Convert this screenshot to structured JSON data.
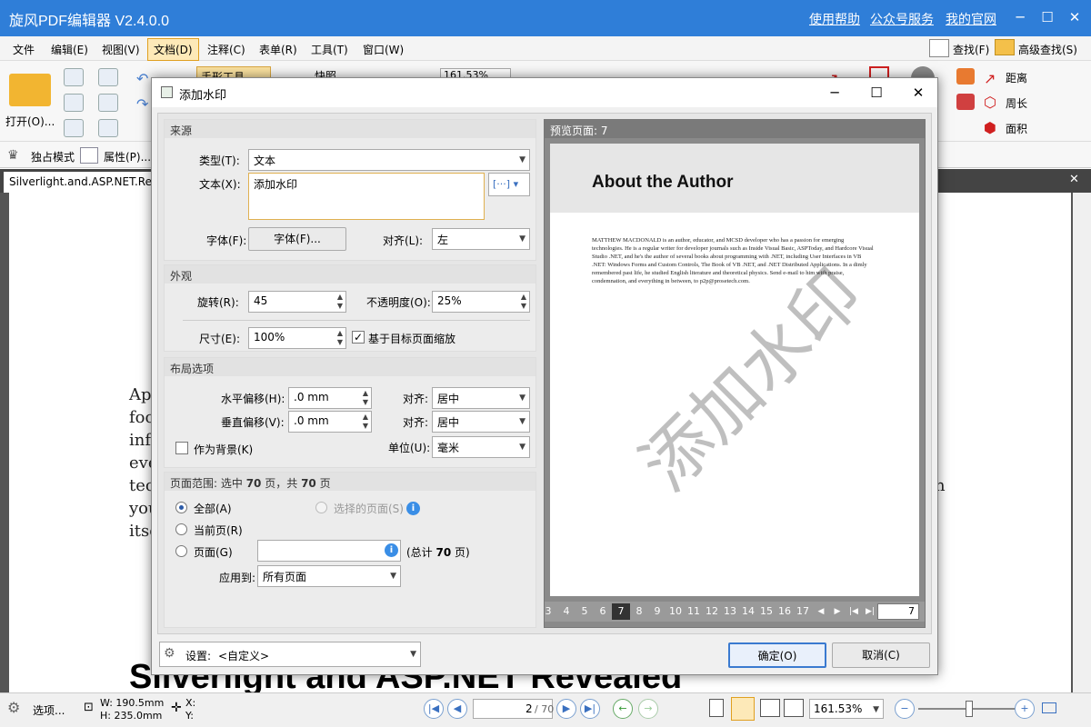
{
  "app": {
    "title": "旋风PDF编辑器 V2.4.0.0",
    "links": [
      "使用帮助",
      "公众号服务",
      "我的官网"
    ]
  },
  "menu": [
    "文件",
    "编辑(E)",
    "视图(V)",
    "文档(D)",
    "注释(C)",
    "表单(R)",
    "工具(T)",
    "窗口(W)"
  ],
  "ribbon": {
    "open_label": "打开(O)...",
    "hand_tool": "手形工具",
    "snapshot": "快照",
    "zoom_value": "161.53%",
    "exclusive_mode": "独占模式",
    "properties": "属性(P)...",
    "find": "查找(F)",
    "advanced_find": "高级查找(S)",
    "distance": "距离",
    "perimeter": "周长",
    "area": "面积"
  },
  "doc_tab": "Silverlight.and.ASP.NET.Revea",
  "page_text": {
    "lines": [
      "Ap",
      "foc",
      "inf",
      "eve",
      "tec",
      "you",
      "itse"
    ],
    "right_fragment": "n",
    "heading": "Silverlight and ASP.NET Revealed"
  },
  "statusbar": {
    "select": "选项...",
    "width": "W: 190.5mm",
    "height": "H: 235.0mm",
    "x": "X:",
    "y": "Y:",
    "page_field": "2",
    "page_total": "/ 70",
    "zoom": "161.53%"
  },
  "dialog": {
    "title": "添加水印",
    "source": {
      "header": "来源",
      "type_label": "类型(T):",
      "type_value": "文本",
      "text_label": "文本(X):",
      "text_value": "添加水印",
      "font_label": "字体(F):",
      "font_button": "字体(F)...",
      "align_label": "对齐(L):",
      "align_value": "左"
    },
    "appearance": {
      "header": "外观",
      "rotation_label": "旋转(R):",
      "rotation_value": "45",
      "opacity_label": "不透明度(O):",
      "opacity_value": "25%",
      "size_label": "尺寸(E):",
      "size_value": "100%",
      "scale_checkbox": "基于目标页面缩放"
    },
    "layout": {
      "header": "布局选项",
      "h_offset_label": "水平偏移(H):",
      "h_offset_value": ".0 mm",
      "v_offset_label": "垂直偏移(V):",
      "v_offset_value": ".0 mm",
      "align1_label": "对齐:",
      "align1_value": "居中",
      "align2_label": "对齐:",
      "align2_value": "居中",
      "unit_label": "单位(U):",
      "unit_value": "毫米",
      "background_checkbox": "作为背景(K)"
    },
    "range": {
      "header_prefix": "页面范围: 选中",
      "selected_count": "70",
      "header_mid": "页，共",
      "total_count": "70",
      "header_suffix": "页",
      "all": "全部(A)",
      "selected_pages": "选择的页面(S)",
      "current_page": "当前页(R)",
      "pages": "页面(G)",
      "pages_total_prefix": "(总计",
      "pages_total_count": "70",
      "pages_total_suffix": "页)",
      "apply_label": "应用到:",
      "apply_value": "所有页面"
    },
    "preview": {
      "header": "预览页面: 7",
      "heading": "About the Author",
      "body": "MATTHEW MACDONALD is an author, educator, and MCSD developer who has a passion for emerging technologies. He is a regular writer for developer journals such as Inside Visual Basic, ASPToday, and Hardcore Visual Studio .NET, and he's the author of several books about programming with .NET, including User Interfaces in VB .NET: Windows Forms and Custom Controls, The Book of VB .NET, and .NET Distributed Applications. In a dimly remembered past life, he studied English literature and theoretical physics. Send e-mail to him with praise, condemnation, and everything in between, to p2p@prosetech.com.",
      "watermark": "添加水印",
      "pages": [
        "3",
        "4",
        "5",
        "6",
        "7",
        "8",
        "9",
        "10",
        "11",
        "12",
        "13",
        "14",
        "15",
        "16",
        "17"
      ],
      "current": "7",
      "page_input": "7"
    },
    "settings_label": "设置:",
    "settings_value": "<自定义>",
    "ok": "确定(O)",
    "cancel": "取消(C)"
  }
}
